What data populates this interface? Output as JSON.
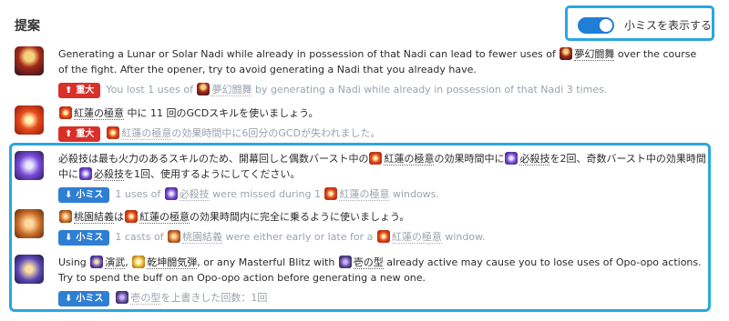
{
  "header": {
    "title": "提案"
  },
  "toggle": {
    "label": "小ミスを表示する",
    "on": true
  },
  "items": [
    {
      "icon": "dream-fists-icon",
      "t1": "Generating a Lunar or Solar Nadi while already in possession of that Nadi can lead to fewer uses of ",
      "s1": "夢幻闘舞",
      "t2": " over the course of the fight. After the opener, try to avoid generating a Nadi that you already have.",
      "severity": "重大",
      "sub1": "You lost 1 uses of ",
      "subskill": "夢幻闘舞",
      "sub2": " by generating a Nadi while already in possession of that Nadi 3 times."
    },
    {
      "icon": "riddle-of-fire-icon",
      "s1": "紅蓮の極意",
      "t2": " 中に 11 回のGCDスキルを使いましょう。",
      "severity": "重大",
      "subskill": "紅蓮の極意",
      "sub2": "の効果時間中に6回分のGCDが失われました。"
    },
    {
      "icon": "the-forbidden-chakra-icon",
      "t1": "必殺技は最も火力のあるスキルのため、開幕回しと偶数バースト中の",
      "s1": "紅蓮の極意",
      "t2": "の効果時間中に",
      "s2": "必殺技",
      "t3": "を2回、奇数バースト中の効果時間中に",
      "s3": "必殺技",
      "t4": "を1回、使用するようにしてください。",
      "severity": "小ミス",
      "sub1": "1 uses of ",
      "subskill": "必殺技",
      "sub2": " were missed during 1 ",
      "subskill2": "紅蓮の極意",
      "sub3": " windows."
    },
    {
      "icon": "brotherhood-icon",
      "s1": "桃園結義",
      "t2": "は",
      "s2": "紅蓮の極意",
      "t3": "の効果時間内に完全に乗るように使いましょう。",
      "severity": "小ミス",
      "sub1": "1 casts of ",
      "subskill": "桃園結義",
      "sub2": " were either early or late for a ",
      "subskill2": "紅蓮の極意",
      "sub3": " window."
    },
    {
      "icon": "masterful-blitz-icon",
      "t1": "Using ",
      "s1": "演武",
      "t2": ", ",
      "s2": "乾坤闘気弾",
      "t3": ", or any Masterful Blitz with ",
      "s3": "壱の型",
      "t4": " already active may cause you to lose uses of Opo-opo actions. Try to spend the buff on an Opo-opo action before generating a new one.",
      "severity": "小ミス",
      "subskill": "壱の型",
      "sub2": "を上書きした回数：1回"
    }
  ],
  "colors": {
    "major": "#d9302a",
    "minor": "#2e7ed4",
    "highlight": "#2aa7df",
    "toggle": "#1f7fd6"
  }
}
